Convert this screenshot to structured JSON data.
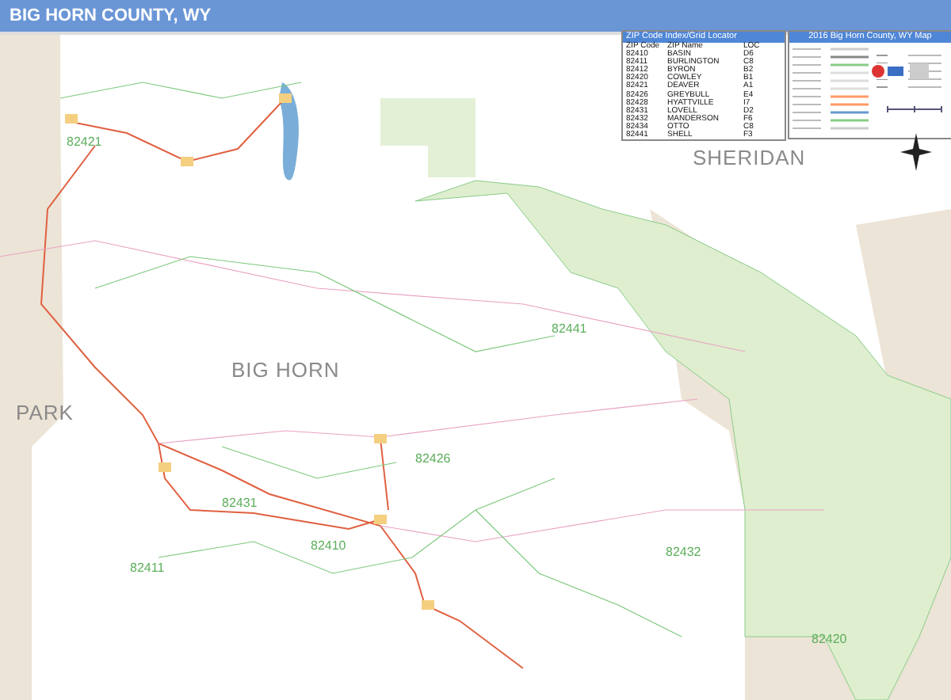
{
  "header": {
    "title": "BIG HORN COUNTY, WY"
  },
  "map": {
    "county_labels": [
      "SHERIDAN",
      "BIG HORN",
      "PARK"
    ],
    "zip_labels": [
      "82421",
      "82441",
      "82426",
      "82431",
      "82410",
      "82411",
      "82432",
      "82420"
    ]
  },
  "zip_index": {
    "title": "ZIP Code Index/Grid Locator",
    "columns": [
      "ZIP Code",
      "ZIP Name",
      "LOC"
    ],
    "rows": [
      [
        "82410",
        "BASIN",
        "D6"
      ],
      [
        "82411",
        "BURLINGTON",
        "C8"
      ],
      [
        "82412",
        "BYRON",
        "B2"
      ],
      [
        "82420",
        "COWLEY",
        "B1"
      ],
      [
        "82421",
        "DEAVER",
        "A1"
      ],
      [
        "82426",
        "GREYBULL",
        "E4"
      ],
      [
        "82428",
        "HYATTVILLE",
        "I7"
      ],
      [
        "82431",
        "LOVELL",
        "D2"
      ],
      [
        "82432",
        "MANDERSON",
        "F6"
      ],
      [
        "82434",
        "OTTO",
        "C8"
      ],
      [
        "82441",
        "SHELL",
        "F3"
      ]
    ]
  },
  "legend": {
    "title": "2016 Big Horn County, WY Map"
  }
}
